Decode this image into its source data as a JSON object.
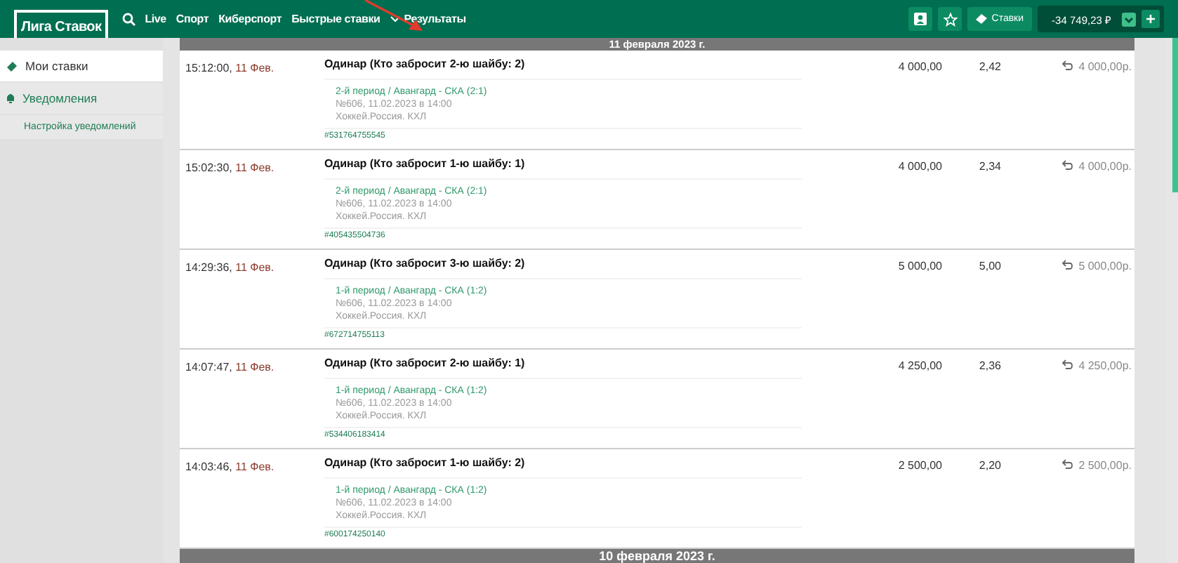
{
  "header": {
    "logo": "Лига Ставок",
    "nav": [
      {
        "label": "Live"
      },
      {
        "label": "Спорт"
      },
      {
        "label": "Киберспорт"
      },
      {
        "label": "Быстрые ставки"
      },
      {
        "label": "Результаты",
        "caret": true
      }
    ],
    "bets_button": "Ставки",
    "balance": "-34 749,23 ₽"
  },
  "sidebar": {
    "items": [
      {
        "label": "Мои ставки",
        "selected": true
      },
      {
        "label": "Уведомления",
        "selected": false,
        "children": [
          {
            "label": "Настройка уведомлений",
            "selected": false
          }
        ]
      }
    ]
  },
  "groups": [
    {
      "date": "11 февраля 2023 г.",
      "bets": [
        {
          "time": "15:12:00,",
          "day": "11 Фев.",
          "title": "Одинар (Кто забросит 2-ю шайбу: 2)",
          "amount": "4 000,00",
          "coefficient": "2,42",
          "returned": "4 000,00р.",
          "event": "2-й период / Авангард - СКА (2:1)",
          "match": "№606, 11.02.2023 в 14:00",
          "league": "Хоккей.Россия. КХЛ",
          "ticket": "#531764755545"
        },
        {
          "time": "15:02:30,",
          "day": "11 Фев.",
          "title": "Одинар (Кто забросит 1-ю шайбу: 1)",
          "amount": "4 000,00",
          "coefficient": "2,34",
          "returned": "4 000,00р.",
          "event": "2-й период / Авангард - СКА (2:1)",
          "match": "№606, 11.02.2023 в 14:00",
          "league": "Хоккей.Россия. КХЛ",
          "ticket": "#405435504736"
        },
        {
          "time": "14:29:36,",
          "day": "11 Фев.",
          "title": "Одинар (Кто забросит 3-ю шайбу: 2)",
          "amount": "5 000,00",
          "coefficient": "5,00",
          "returned": "5 000,00р.",
          "event": "1-й период / Авангард - СКА (1:2)",
          "match": "№606, 11.02.2023 в 14:00",
          "league": "Хоккей.Россия. КХЛ",
          "ticket": "#672714755113"
        },
        {
          "time": "14:07:47,",
          "day": "11 Фев.",
          "title": "Одинар (Кто забросит 2-ю шайбу: 1)",
          "amount": "4 250,00",
          "coefficient": "2,36",
          "returned": "4 250,00р.",
          "event": "1-й период / Авангард - СКА (1:2)",
          "match": "№606, 11.02.2023 в 14:00",
          "league": "Хоккей.Россия. КХЛ",
          "ticket": "#534406183414"
        },
        {
          "time": "14:03:46,",
          "day": "11 Фев.",
          "title": "Одинар (Кто забросит 1-ю шайбу: 2)",
          "amount": "2 500,00",
          "coefficient": "2,20",
          "returned": "2 500,00р.",
          "event": "1-й период / Авангард - СКА (1:2)",
          "match": "№606, 11.02.2023 в 14:00",
          "league": "Хоккей.Россия. КХЛ",
          "ticket": "#600174250140"
        }
      ]
    },
    {
      "date": "10 февраля 2023 г."
    }
  ]
}
